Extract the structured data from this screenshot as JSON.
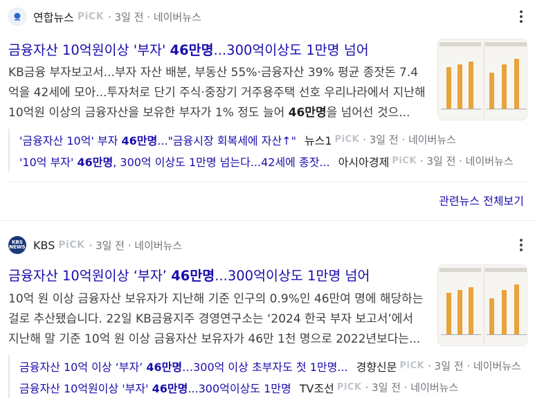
{
  "articles": [
    {
      "source": {
        "name": "연합뉴스",
        "pick": "PiCK",
        "meta": "· 3일 전 · 네이버뉴스",
        "logo_text": "연합뉴스"
      },
      "title": {
        "pre": "금융자산 10억원이상 '부자' ",
        "bold": "46만명",
        "post": "...300억이상도 1만명 넘어"
      },
      "snippet": {
        "pre": "KB금융 부자보고서...부자 자산 배분, 부동산 55%·금융자산 39% 평균 종잣돈 7.4억을 42세에 모아...투자처로 단기 주식·중장기 거주용주택 선호 우리나라에서 지난해 10억원 이상의 금융자산을 보유한 부자가 1% 정도 늘어 ",
        "bold": "46만명",
        "post": "을 넘어선 것으..."
      },
      "related": [
        {
          "pre": "'금융자산 10억' 부자 ",
          "bold": "46만명",
          "post": "...\"금융시장 회복세에 자산↑\"",
          "source": "뉴스1",
          "pick": "PiCK",
          "meta": "· 3일 전 · 네이버뉴스"
        },
        {
          "pre": "'10억 부자' ",
          "bold": "46만명",
          "post": ", 300억 이상도 1만명 넘는다...42세에 종잣...",
          "source": "아시아경제",
          "pick": "PiCK",
          "meta": "· 3일 전 · 네이버뉴스"
        }
      ],
      "more_label": "관련뉴스 전체보기"
    },
    {
      "source": {
        "name": "KBS",
        "pick": "PiCK",
        "meta": "· 3일 전 · 네이버뉴스",
        "logo_text": "KBS NEWS"
      },
      "title": {
        "pre": "금융자산 10억원이상 ‘부자’ ",
        "bold": "46만명",
        "post": "...300억이상도 1만명 넘어"
      },
      "snippet": {
        "pre": "10억 원 이상 금융자산 보유자가 지난해 기준 인구의 0.9%인 46만여 명에 해당하는 걸로 추산됐습니다. 22일 KB금융지주 경영연구소는 ‘2024 한국 부자 보고서’에서 지난해 말 기준 10억 원 이상 금융자산 보유자가 46만 1천 명으로 2022년보다는...",
        "bold": "",
        "post": ""
      },
      "related": [
        {
          "pre": "금융자산 10억 이상 ‘부자’ ",
          "bold": "46만명",
          "post": "…300억 이상 초부자도 첫 1만명...",
          "source": "경향신문",
          "pick": "PiCK",
          "meta": "· 3일 전 · 네이버뉴스"
        },
        {
          "pre": "금융자산 10억원이상 '부자' ",
          "bold": "46만명",
          "post": "...300억이상도 1만명",
          "source": "TV조선",
          "pick": "PiCK",
          "meta": "· 3일 전 · 네이버뉴스"
        }
      ]
    }
  ],
  "colors": {
    "link": "#1a0dab",
    "meta": "#70757a",
    "pick": "#c0c4ca",
    "bar": "#e8a33a"
  }
}
